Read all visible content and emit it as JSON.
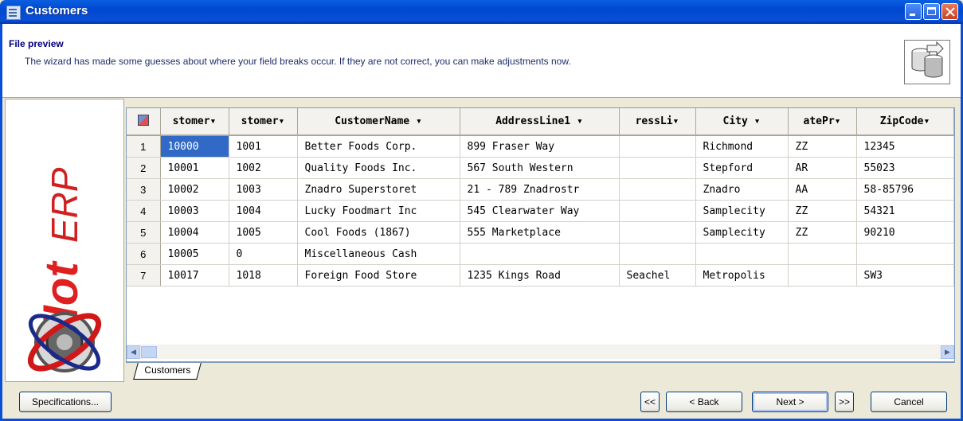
{
  "window": {
    "title": "Customers"
  },
  "header": {
    "title": "File preview",
    "description": "The wizard has made some guesses about where your field breaks occur. If they are not correct, you can make adjustments now."
  },
  "logo": {
    "text": "Pilot ERP"
  },
  "grid": {
    "columns": [
      "stomer▾",
      "stomer▾",
      "CustomerName ▾",
      "AddressLine1 ▾",
      "ressLi▾",
      "City ▾",
      "atePr▾",
      "ZipCode▾"
    ],
    "rows": [
      {
        "n": "1",
        "cells": [
          "10000",
          "1001",
          "Better Foods Corp.",
          "899 Fraser Way",
          "",
          "Richmond",
          "ZZ",
          "12345"
        ]
      },
      {
        "n": "2",
        "cells": [
          "10001",
          "1002",
          "Quality Foods Inc.",
          "567 South Western",
          "",
          "Stepford",
          "AR",
          "55023"
        ]
      },
      {
        "n": "3",
        "cells": [
          "10002",
          "1003",
          "Znadro Superstoret",
          "21 - 789 Znadrostr",
          "",
          "Znadro",
          "AA",
          "58-85796"
        ]
      },
      {
        "n": "4",
        "cells": [
          "10003",
          "1004",
          "Lucky Foodmart Inc",
          "545 Clearwater Way",
          "",
          "Samplecity",
          "ZZ",
          "54321"
        ]
      },
      {
        "n": "5",
        "cells": [
          "10004",
          "1005",
          "Cool Foods (1867)",
          "555 Marketplace",
          "",
          "Samplecity",
          "ZZ",
          "90210"
        ]
      },
      {
        "n": "6",
        "cells": [
          "10005",
          "0",
          "Miscellaneous Cash",
          "",
          "",
          "",
          "",
          ""
        ]
      },
      {
        "n": "7",
        "cells": [
          "10017",
          "1018",
          "Foreign Food Store",
          "1235 Kings Road",
          "Seachel",
          "Metropolis",
          "",
          "SW3"
        ]
      }
    ],
    "sheet_tab": "Customers"
  },
  "buttons": {
    "specifications": "Specifications...",
    "first": "<<",
    "back": "< Back",
    "next": "Next >",
    "last": ">>",
    "cancel": "Cancel"
  }
}
